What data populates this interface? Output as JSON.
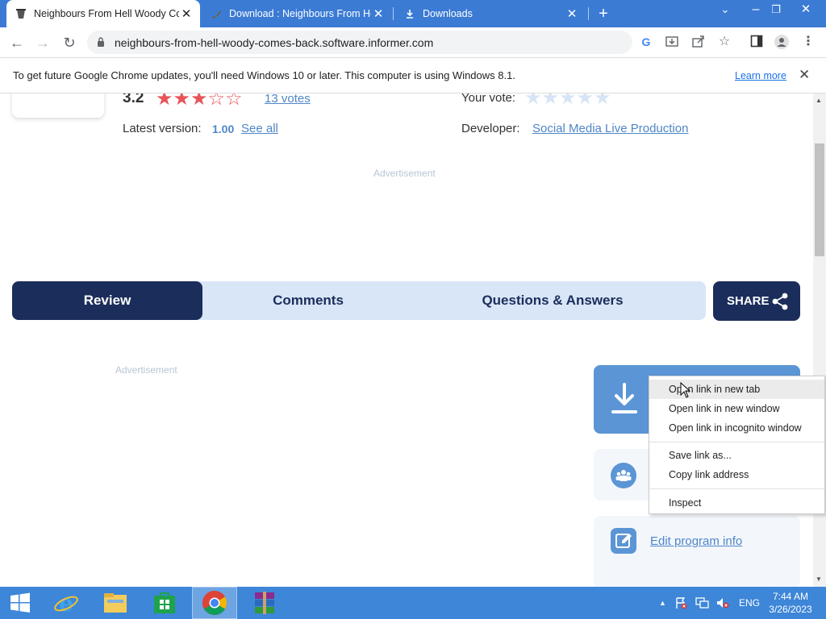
{
  "browser": {
    "tabs": [
      {
        "title": "Neighbours From Hell Woody Comes Back",
        "active": true
      },
      {
        "title": "Download : Neighbours From Hell Woody Comes Back",
        "active": false
      },
      {
        "title": "Downloads",
        "active": false
      }
    ],
    "new_tab_label": "+",
    "url": "neighbours-from-hell-woody-comes-back.software.informer.com"
  },
  "infobar": {
    "message": "To get future Google Chrome updates, you'll need Windows 10 or later. This computer is using Windows 8.1.",
    "learn_more": "Learn more"
  },
  "program": {
    "rating": "3.2",
    "rating_value": 3.2,
    "rating_max": 5,
    "votes": "13 votes",
    "your_vote_label": "Your vote:",
    "latest_version_label": "Latest version:",
    "latest_version": "1.00",
    "see_all": "See all",
    "developer_label": "Developer:",
    "developer": "Social Media Live Production"
  },
  "ads": {
    "label_top": "Advertisement",
    "label_left": "Advertisement"
  },
  "page_tabs": [
    {
      "label": "Review",
      "active": true
    },
    {
      "label": "Comments",
      "active": false
    },
    {
      "label": "Questions & Answers",
      "active": false
    }
  ],
  "share_label": "SHARE",
  "sidebar": {
    "edit_program_info": "Edit program info"
  },
  "context_menu": {
    "items": [
      "Open link in new tab",
      "Open link in new window",
      "Open link in incognito window",
      "Save link as...",
      "Copy link address",
      "Inspect"
    ]
  },
  "taskbar": {
    "language": "ENG",
    "time": "7:44 AM",
    "date": "3/26/2023"
  },
  "colors": {
    "chrome_tabstrip": "#3b7bd4",
    "page_accent_dark": "#1b2d5b",
    "page_accent_light": "#d8e6f7",
    "link": "#4f86c6",
    "star": "#e8535a",
    "taskbar": "#3d86d8"
  }
}
